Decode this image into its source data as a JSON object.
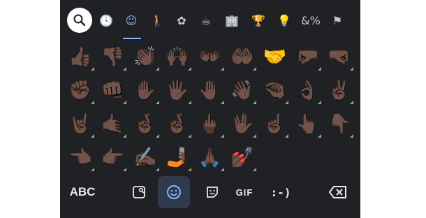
{
  "category_bar": {
    "items": [
      {
        "name": "search-icon",
        "glyph": ""
      },
      {
        "name": "recent-icon",
        "glyph": "🕓"
      },
      {
        "name": "smileys-icon",
        "glyph": "☺"
      },
      {
        "name": "people-icon",
        "glyph": "🚶"
      },
      {
        "name": "animals-nature-icon",
        "glyph": "✿"
      },
      {
        "name": "food-drink-icon",
        "glyph": "☕"
      },
      {
        "name": "travel-places-icon",
        "glyph": "🏢"
      },
      {
        "name": "activities-icon",
        "glyph": "🏆"
      },
      {
        "name": "objects-icon",
        "glyph": "💡"
      },
      {
        "name": "symbols-icon",
        "glyph": "&%"
      },
      {
        "name": "flags-icon",
        "glyph": "⚑"
      }
    ],
    "active_index": 2,
    "active_color": "#8ab4f8"
  },
  "emoji_grid": {
    "rows": [
      [
        "👍🏿",
        "👎🏿",
        "👏🏿",
        "🙌🏿",
        "👐🏿",
        "🤲🏿",
        "🤝",
        "🤛🏿",
        "🤜🏿"
      ],
      [
        "✊🏿",
        "👊🏿",
        "✋🏿",
        "🖐🏿",
        "🤚🏿",
        "👋🏿",
        "🤏🏿",
        "👌🏿",
        "✌🏿"
      ],
      [
        "🤘🏿",
        "🤙🏿",
        "🤞🏿",
        "🤞🏿",
        "🖕🏿",
        "🖖🏿",
        "☝🏿",
        "👆🏿",
        "👇🏿"
      ],
      [
        "👈🏿",
        "👉🏿",
        "✍🏿",
        "🤳🏿",
        "🙏🏿",
        "💅🏿"
      ]
    ],
    "has_skin_variants": [
      [
        true,
        true,
        true,
        true,
        true,
        true,
        false,
        true,
        true
      ],
      [
        true,
        true,
        true,
        true,
        true,
        true,
        true,
        true,
        true
      ],
      [
        true,
        true,
        true,
        true,
        true,
        true,
        true,
        true,
        true
      ],
      [
        true,
        true,
        true,
        true,
        true,
        true
      ]
    ]
  },
  "bottom_bar": {
    "abc_label": "ABC",
    "gif_label": "GIF",
    "emoticon_label": ":-)",
    "icons": {
      "stickers": "sticker-search-icon",
      "emoji": "emoji-icon",
      "kaomoji": "sticker-icon",
      "backspace": "backspace-icon"
    }
  },
  "colors": {
    "background": "#202124",
    "icon": "#c4c7c5",
    "accent": "#8ab4f8",
    "active_tab_bg": "#2f3b4d"
  }
}
